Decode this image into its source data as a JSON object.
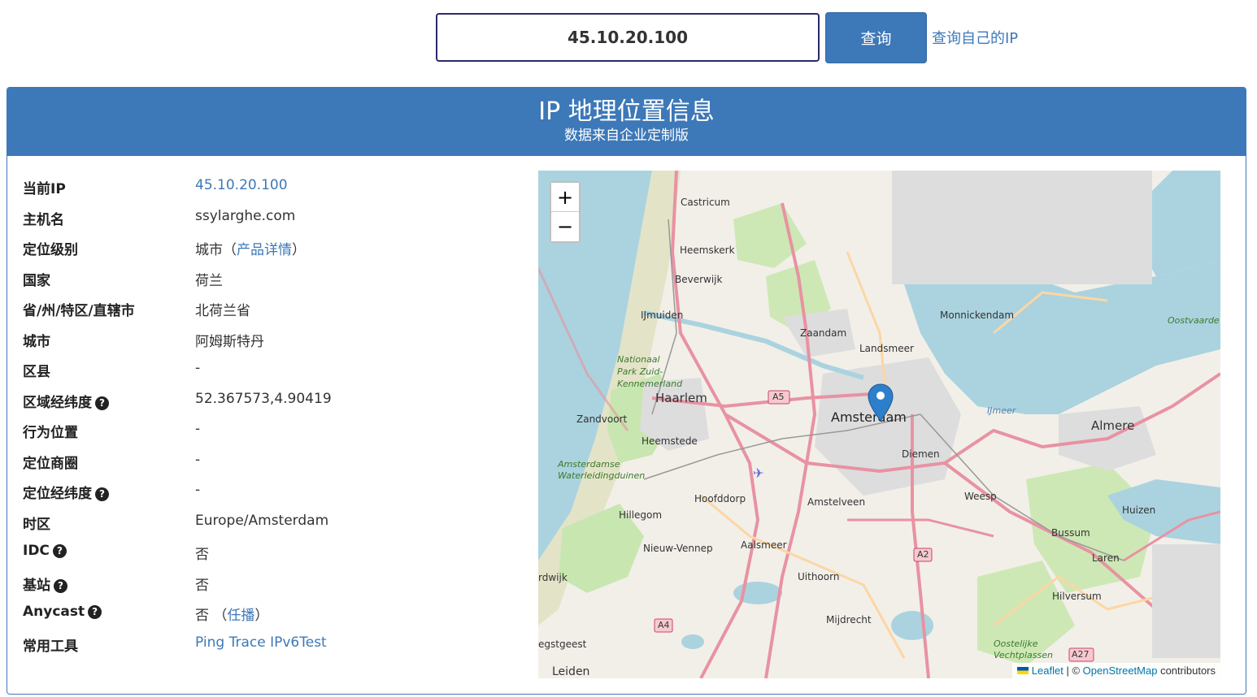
{
  "search": {
    "ip_value": "45.10.20.100",
    "query_button": "查询",
    "self_ip_link": "查询自己的IP"
  },
  "card": {
    "title": "IP 地理位置信息",
    "subtitle": "数据来自企业定制版"
  },
  "info": {
    "rows": [
      {
        "label": "当前IP",
        "value": "45.10.20.100"
      },
      {
        "label": "主机名",
        "value": "ssylarghe.com"
      },
      {
        "label": "定位级别",
        "value": "城市",
        "paren_open": "（",
        "link": "产品详情",
        "paren_close": "）"
      },
      {
        "label": "国家",
        "value": "荷兰"
      },
      {
        "label": "省/州/特区/直辖市",
        "value": "北荷兰省"
      },
      {
        "label": "城市",
        "value": "阿姆斯特丹"
      },
      {
        "label": "区县",
        "value": "-"
      },
      {
        "label": "区域经纬度",
        "value": "52.367573,4.90419"
      },
      {
        "label": "行为位置",
        "value": "-"
      },
      {
        "label": "定位商圈",
        "value": "-"
      },
      {
        "label": "定位经纬度",
        "value": "-"
      },
      {
        "label": "时区",
        "value": "Europe/Amsterdam"
      },
      {
        "label": "IDC",
        "value": "否"
      },
      {
        "label": "基站",
        "value": "否"
      },
      {
        "label": "Anycast",
        "value": "否",
        "paren_open": "（",
        "link": "任播",
        "paren_close": "）"
      },
      {
        "label": "常用工具",
        "links": [
          "Ping",
          "Trace",
          "IPv6Test"
        ]
      }
    ]
  },
  "map": {
    "zoom_in": "+",
    "zoom_out": "−",
    "attribution": {
      "leaflet": "Leaflet",
      "sep": "| ©",
      "osm": "OpenStreetMap",
      "suffix": "contributors"
    },
    "labels": {
      "castricum": "Castricum",
      "heemskerk": "Heemskerk",
      "beverwijk": "Beverwijk",
      "ijmuiden": "IJmuiden",
      "zaandam": "Zaandam",
      "monnickendam": "Monnickendam",
      "landsmeer": "Landsmeer",
      "national_park": "Nationaal\nPark Zuid-\nKennemerland",
      "haarlem": "Haarlem",
      "zandvoort": "Zandvoort",
      "heemstede": "Heemstede",
      "amsterdam": "Amsterdam",
      "diemen": "Diemen",
      "almere": "Almere",
      "ijmeer": "IJmeer",
      "oostvaarders": "Oostvaarde",
      "amsterdamse": "Amsterdamse\nWaterleidingduinen",
      "hoofddorp": "Hoofddorp",
      "hillegom": "Hillegom",
      "amstelveen": "Amstelveen",
      "weesp": "Weesp",
      "huizen": "Huizen",
      "bussum": "Bussum",
      "nieuw_vennep": "Nieuw-Vennep",
      "aalsmeer": "Aalsmeer",
      "uithoorn": "Uithoorn",
      "laren": "Laren",
      "hilversum": "Hilversum",
      "noordwijk": "rdwijk",
      "mijdrecht": "Mijdrecht",
      "oegstgeest": "egstgeest",
      "leiden": "Leiden",
      "oostelijke": "Oostelijke\nVechtplassen",
      "a5": "A5",
      "a2": "A2",
      "a4": "A4",
      "a27": "A27"
    }
  }
}
